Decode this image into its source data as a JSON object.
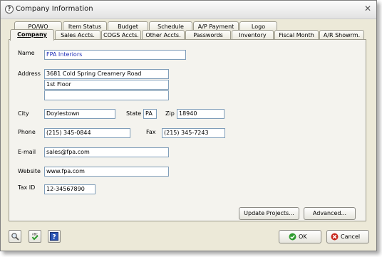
{
  "window": {
    "title": "Company Information"
  },
  "tabs_back": [
    "PO/WO",
    "Item Status",
    "Budget",
    "Schedule",
    "A/P Payment",
    "Logo"
  ],
  "tabs_front": [
    "Company",
    "Sales Accts.",
    "COGS Accts.",
    "Other Accts.",
    "Passwords",
    "Inventory",
    "Fiscal Month",
    "A/R Showrm."
  ],
  "active_tab": "Company",
  "form": {
    "name_label": "Name",
    "name_value": "FPA Interiors",
    "address_label": "Address",
    "address_line1": "3681 Cold Spring Creamery Road",
    "address_line2": "1st Floor",
    "address_line3": "",
    "city_label": "City",
    "city_value": "Doylestown",
    "state_label": "State",
    "state_value": "PA",
    "zip_label": "Zip",
    "zip_value": "18940",
    "phone_label": "Phone",
    "phone_value": "(215) 345-0844",
    "fax_label": "Fax",
    "fax_value": "(215) 345-7243",
    "email_label": "E-mail",
    "email_value": "sales@fpa.com",
    "website_label": "Website",
    "website_value": "www.fpa.com",
    "taxid_label": "Tax ID",
    "taxid_value": "12-34567890"
  },
  "buttons": {
    "update_projects": "Update Projects...",
    "advanced": "Advanced...",
    "ok": "OK",
    "cancel": "Cancel",
    "spell_icon_text": "ABC"
  },
  "colors": {
    "link_text": "#1f2fb8",
    "ok_green": "#2e9b2e",
    "cancel_red": "#c8281e"
  }
}
